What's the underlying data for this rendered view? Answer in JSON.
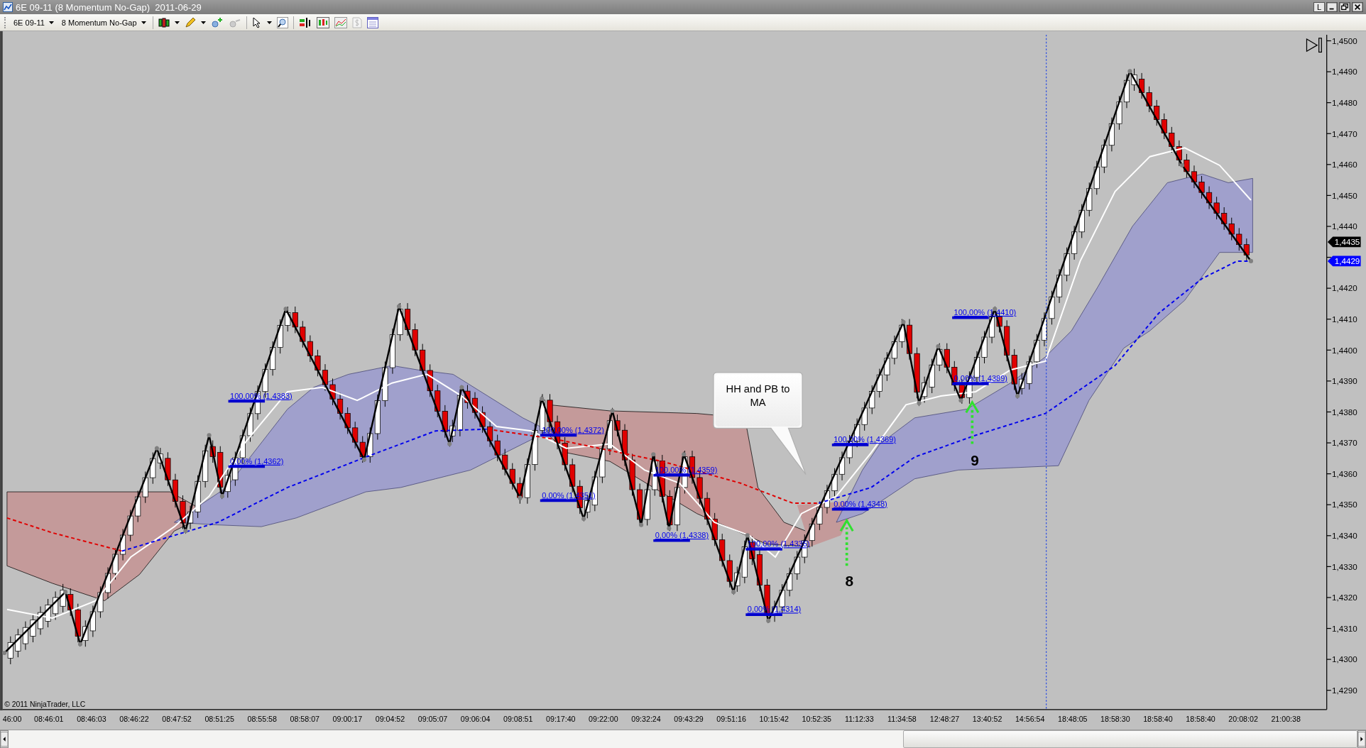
{
  "window": {
    "title": "6E 09-11 (8 Momentum No-Gap)  2011-06-29",
    "link_button": "L"
  },
  "toolbar": {
    "instrument": "6E 09-11",
    "bar_type": "8 Momentum No-Gap"
  },
  "chart": {
    "price_labels": [
      "1,4500",
      "1,4490",
      "1,4480",
      "1,4470",
      "1,4460",
      "1,4450",
      "1,4440",
      "1,4420",
      "1,4410",
      "1,4400",
      "1,4390",
      "1,4380",
      "1,4370",
      "1,4360",
      "1,4350",
      "1,4340",
      "1,4330",
      "1,4320",
      "1,4310",
      "1,4300",
      "1,4290"
    ],
    "price_markers": [
      {
        "label": "1,4435",
        "color": "#000000"
      },
      {
        "label": "1,4429",
        "color": "#0000ff"
      }
    ],
    "fib_labels": [
      "100,00% (1,4383)",
      "0,00% (1,4362)",
      "100,00% (1,4372)",
      "0,00% (1,4351)",
      "100,00% (1,4359)",
      "0,00% (1,4338)",
      "100,00% (1,4335)",
      "0,00% (1,4314)",
      "100,00% (1,4369)",
      "0,00% (1,4348)",
      "100,00% (1,4410)",
      "0,00% (1,4389)"
    ],
    "callout": "HH and PB to MA",
    "signals": [
      "8",
      "9"
    ],
    "copyright": "© 2011 NinjaTrader, LLC",
    "time_labels": [
      "46:00",
      "08:46:01",
      "08:46:03",
      "08:46:22",
      "08:47:52",
      "08:51:25",
      "08:55:58",
      "08:58:07",
      "09:00:17",
      "09:04:52",
      "09:05:07",
      "09:06:04",
      "09:08:51",
      "09:17:40",
      "09:22:00",
      "09:32:24",
      "09:43:29",
      "09:51:16",
      "10:15:42",
      "10:52:35",
      "11:12:33",
      "11:34:58",
      "12:48:27",
      "13:40:52",
      "14:56:54",
      "18:48:05",
      "18:58:30",
      "18:58:40",
      "18:58:40",
      "20:08:02",
      "21:00:38"
    ]
  }
}
